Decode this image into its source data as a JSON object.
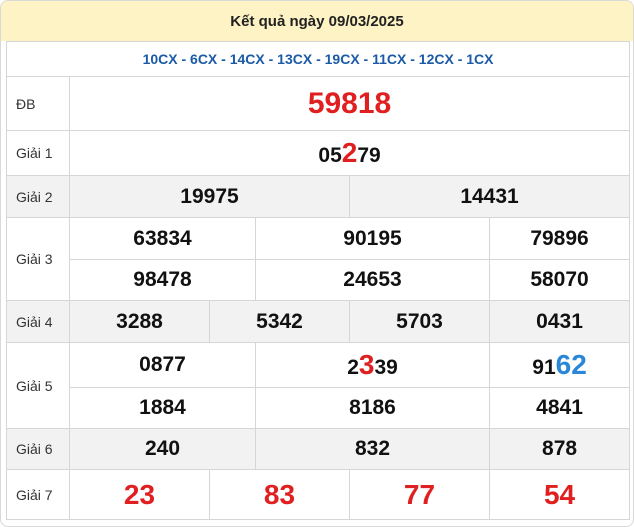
{
  "header": {
    "title": "Kết quả ngày 09/03/2025"
  },
  "codes": "10CX - 6CX - 14CX - 13CX - 19CX - 11CX - 12CX - 1CX",
  "db": {
    "label": "ĐB",
    "value": "59818"
  },
  "g1": {
    "label": "Giải 1",
    "pre": "05",
    "hl": "2",
    "post": "79"
  },
  "g2": {
    "label": "Giải 2",
    "values": [
      "19975",
      "14431"
    ]
  },
  "g3": {
    "label": "Giải 3",
    "values": [
      "63834",
      "90195",
      "79896",
      "98478",
      "24653",
      "58070"
    ]
  },
  "g4": {
    "label": "Giải 4",
    "values": [
      "3288",
      "5342",
      "5703",
      "0431"
    ]
  },
  "g5": {
    "label": "Giải 5",
    "a": {
      "pre": "0877"
    },
    "b": {
      "pre": "2",
      "hl": "3",
      "post": "39"
    },
    "c": {
      "pre": "91",
      "hl": "62"
    },
    "values2": [
      "1884",
      "8186",
      "4841"
    ]
  },
  "g6": {
    "label": "Giải 6",
    "values": [
      "240",
      "832",
      "878"
    ]
  },
  "g7": {
    "label": "Giải 7",
    "values": [
      "23",
      "83",
      "77",
      "54"
    ]
  },
  "colors": {
    "red": "#e02020",
    "blue": "#2a87d8",
    "header_bg": "#fdf3c4",
    "codes": "#1a5aa6"
  }
}
